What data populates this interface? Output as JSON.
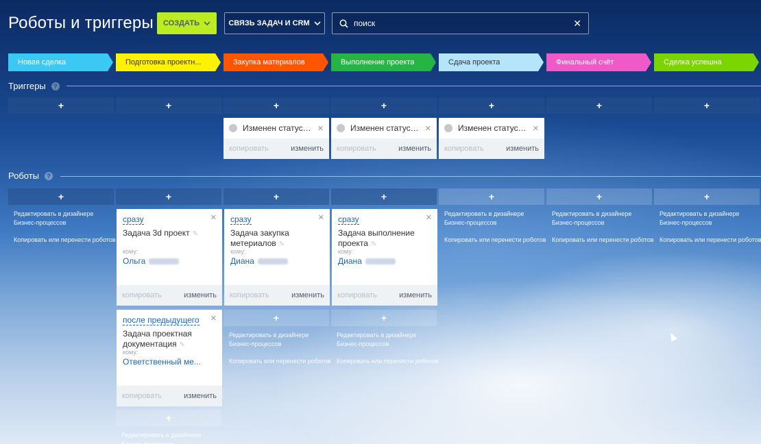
{
  "header": {
    "title": "Роботы и триггеры",
    "create_label": "СОЗДАТЬ",
    "link_label": "СВЯЗЬ ЗАДАЧ И CRM",
    "search_placeholder": "поиск"
  },
  "stages": [
    {
      "label": "Новая сделка",
      "bg": "#3bc8f5",
      "fg": "#ffffff"
    },
    {
      "label": "Подготовка проектн...",
      "bg": "#fff200",
      "fg": "#333333"
    },
    {
      "label": "Закупка материалов",
      "bg": "#ff5500",
      "fg": "#ffffff"
    },
    {
      "label": "Выполнение проекта",
      "bg": "#26b443",
      "fg": "#ffffff"
    },
    {
      "label": "Сдача проекта",
      "bg": "#b4e5fa",
      "fg": "#333333"
    },
    {
      "label": "Финальный счёт",
      "bg": "#f05ac8",
      "fg": "#ffffff"
    },
    {
      "label": "Сделка успешна",
      "bg": "#7bd500",
      "fg": "#ffffff"
    }
  ],
  "triggers": {
    "title": "Триггеры",
    "add_label": "+",
    "cards": [
      {
        "text": "Изменен статус з...",
        "copy": "копировать",
        "edit": "изменить"
      },
      {
        "text": "Изменен статус з...",
        "copy": "копировать",
        "edit": "изменить"
      },
      {
        "text": "Изменен статус з...",
        "copy": "копировать",
        "edit": "изменить"
      }
    ]
  },
  "robots": {
    "title": "Роботы",
    "add_label": "+",
    "hint_edit": "Редактировать в дизайнере Бизнес-процессов",
    "hint_copy": "Копировать или перенести роботов",
    "to_label": "кому:",
    "copy": "копировать",
    "edit": "изменить",
    "cards": [
      {
        "when": "сразу",
        "name": "Задача 3d проект",
        "to": "Ольга"
      },
      {
        "when": "сразу",
        "name": "Задача закупка метериалов",
        "to": "Диана"
      },
      {
        "when": "сразу",
        "name": "Задача выполнение проекта",
        "to": "Диана"
      },
      {
        "when": "после предыдущего",
        "name": "Задача проектная документация",
        "to": "Ответственный ме..."
      }
    ]
  },
  "icons": {
    "search": "search-icon",
    "clear": "close-icon",
    "help": "help-icon",
    "chevron": "chevron-down-icon"
  }
}
